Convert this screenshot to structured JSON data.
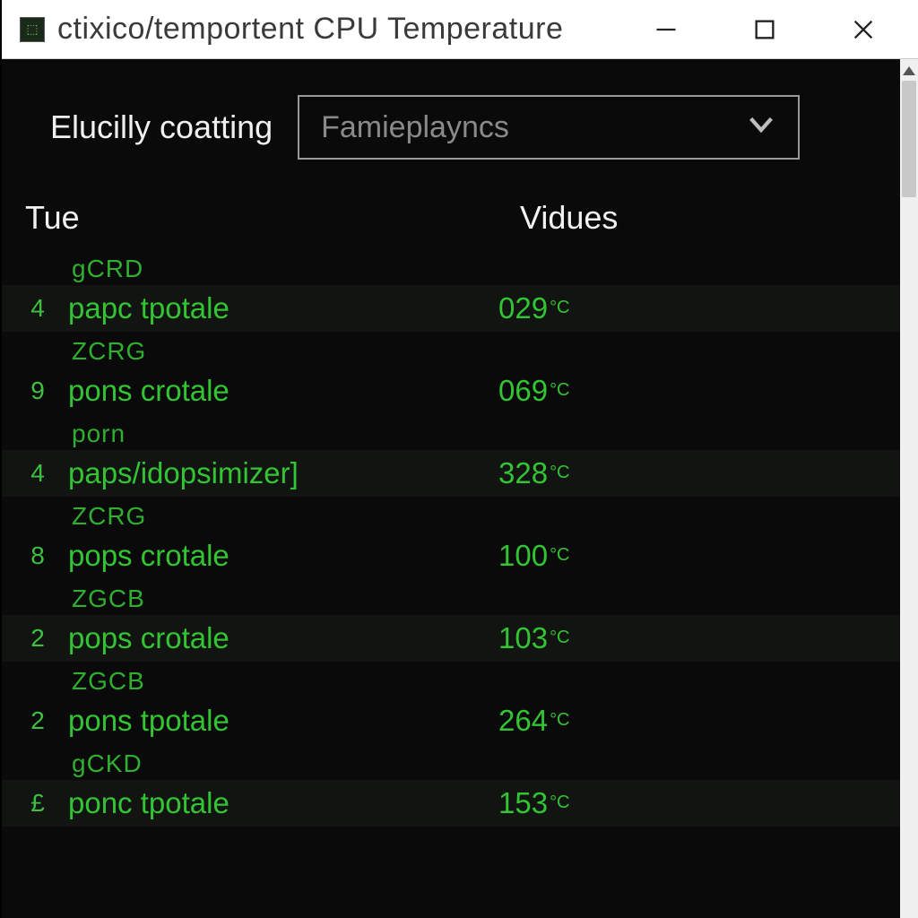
{
  "window": {
    "title": "ctixico/temportent CPU Temperature"
  },
  "toolbar": {
    "label": "Elucilly coatting",
    "select_placeholder": "Famieplayncs"
  },
  "table": {
    "col_name": "Tue",
    "col_value": "Vidues"
  },
  "unit": "°C",
  "rows": [
    {
      "group": "gCRD",
      "badge": "4",
      "name": "papc tpotale",
      "value": "029"
    },
    {
      "group": "ZCRG",
      "badge": "9",
      "name": "pons crotale",
      "value": "069"
    },
    {
      "group": "porn",
      "badge": "4",
      "name": "paps/idopsimizer]",
      "value": "328"
    },
    {
      "group": "ZCRG",
      "badge": "8",
      "name": "pops crotale",
      "value": "100"
    },
    {
      "group": "ZGCB",
      "badge": "2",
      "name": "pops crotale",
      "value": "103"
    },
    {
      "group": "ZGCB",
      "badge": "2",
      "name": "pons tpotale",
      "value": "264"
    },
    {
      "group": "gCKD",
      "badge": "£",
      "name": "ponc tpotale",
      "value": "153"
    }
  ]
}
